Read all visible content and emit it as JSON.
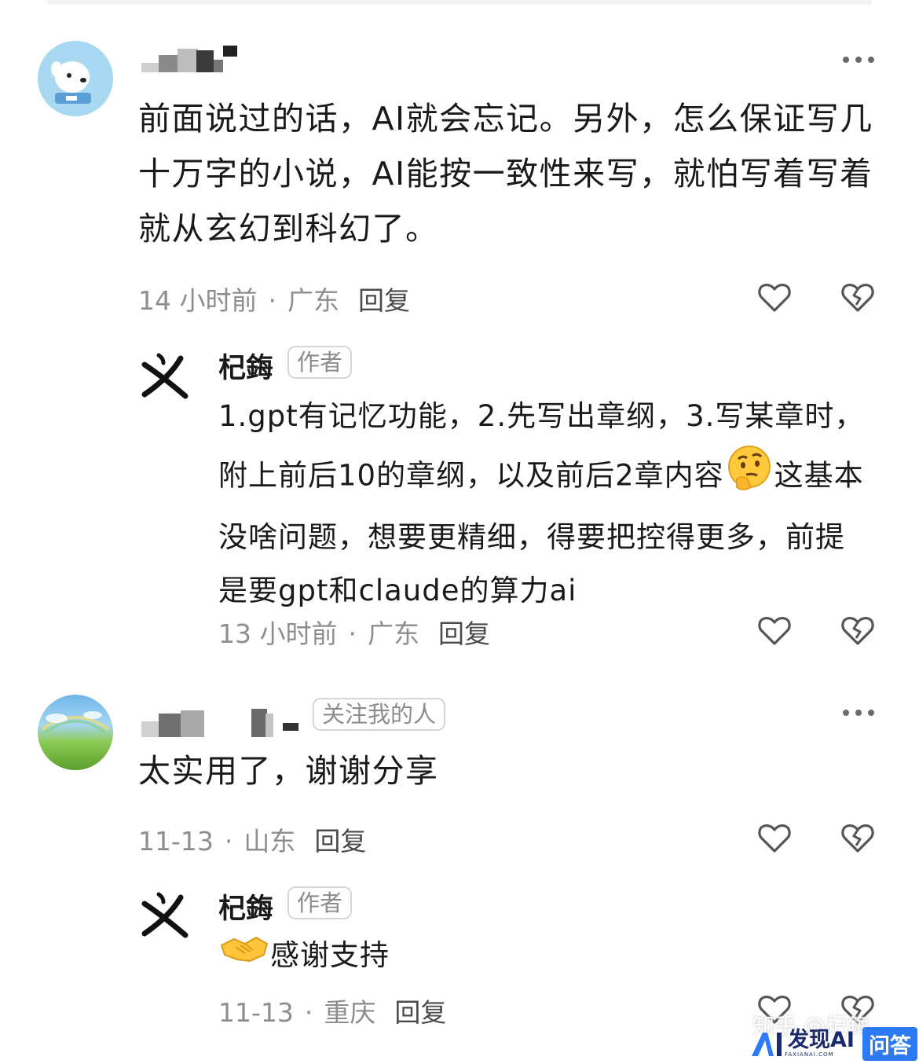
{
  "comments": [
    {
      "text": "前面说过的话，AI就会忘记。另外，怎么保证写几十万字的小说，AI能按一致性来写，就怕写着写着就从玄幻到科幻了。",
      "time": "14 小时前",
      "location": "广东",
      "reply_label": "回复",
      "reply": {
        "author": "杞鋂",
        "badge": "作者",
        "text_before_emoji": "1.gpt有记忆功能，2.先写出章纲，3.写某章时，附上前后10的章纲，以及前后2章内容",
        "emoji": "thinking-face-emoji",
        "text_after_emoji": "这基本没啥问题，想要更精细，得要把控得更多，前提是要gpt和claude的算力ai",
        "time": "13 小时前",
        "location": "广东",
        "reply_label": "回复"
      }
    },
    {
      "follow_badge": "关注我的人",
      "text": "太实用了，谢谢分享",
      "time": "11-13",
      "location": "山东",
      "reply_label": "回复",
      "reply": {
        "author": "杞鋂",
        "badge": "作者",
        "emoji": "handshake-emoji",
        "text": "感谢支持",
        "time": "11-13",
        "location": "重庆",
        "reply_label": "回复"
      }
    }
  ],
  "watermark": {
    "site": "知乎",
    "handle": "@杞鋂"
  },
  "brand": {
    "name": "发现AI",
    "domain": "FAXIANAI.COM",
    "qa": "问答"
  },
  "colors": {
    "text": "#1a1a1a",
    "meta": "#8e8e8e",
    "brand_blue": "#2d7bf4"
  }
}
